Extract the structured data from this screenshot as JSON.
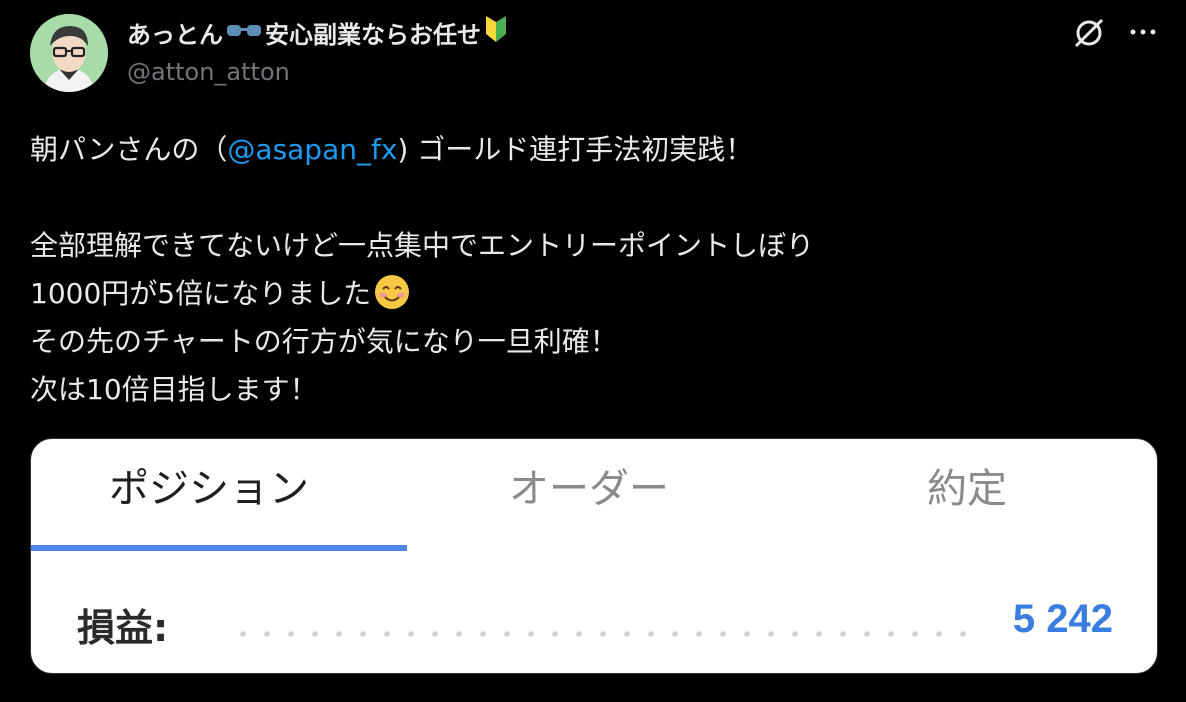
{
  "author": {
    "display_name": "あっとん",
    "display_name_suffix": "安心副業ならお任せ",
    "handle": "@atton_atton"
  },
  "icons": {
    "avatar": "avatar",
    "glasses_emoji": "eyeglasses-icon",
    "beginner_emoji": "beginner-mark-icon",
    "grok": "grok-icon",
    "more": "more-options-icon",
    "smile_emoji": "smiling-face-icon"
  },
  "tweet": {
    "line1_prefix": "朝パンさんの（",
    "line1_mention": "@asapan_fx",
    "line1_suffix": ") ゴールド連打手法初実践！",
    "line2": "全部理解できてないけど一点集中でエントリーポイントしぼり",
    "line3": "1000円が5倍になりました",
    "line4": "その先のチャートの行方が気になり一旦利確！",
    "line5": "次は10倍目指します！"
  },
  "card": {
    "tabs": [
      "ポジション",
      "オーダー",
      "約定"
    ],
    "active_tab": "ポジション",
    "pnl_label": "損益:",
    "pnl_value": "5 242"
  },
  "colors": {
    "background": "#000000",
    "mention": "#1d9bf0",
    "tab_underline": "#4e86e6",
    "pnl_value": "#3a7de0"
  }
}
